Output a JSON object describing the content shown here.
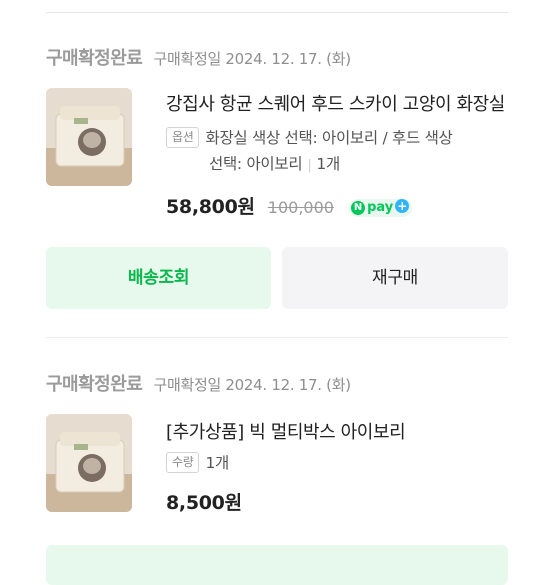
{
  "orders": [
    {
      "status": "구매확정완료",
      "confirm_date": "구매확정일 2024. 12. 17. (화)",
      "product_title": "강집사 항균 스퀘어 후드 스카이 고양이 화장실",
      "option_badge": "옵션",
      "option_text_line1": "화장실 색상 선택: 아이보리 / 후드 색상",
      "option_text_line2": "선택: 아이보리",
      "quantity": "1개",
      "price": "58,800원",
      "original_price": "100,000",
      "npay_label": "pay"
    },
    {
      "status": "구매확정완료",
      "confirm_date": "구매확정일 2024. 12. 17. (화)",
      "product_title": "[추가상품] 빅 멀티박스 아이보리",
      "option_badge": "수량",
      "quantity": "1개",
      "price": "8,500원"
    }
  ],
  "buttons": {
    "track_delivery": "배송조회",
    "rebuy": "재구매"
  },
  "colors": {
    "accent_green": "#09b84b",
    "accent_green_bg": "#e7f8ec",
    "neutral_button_bg": "#f4f4f6",
    "status_gray": "#9b9b9b"
  },
  "icons": [
    "npay-plus-badge-icon",
    "product-thumbnail-image"
  ]
}
